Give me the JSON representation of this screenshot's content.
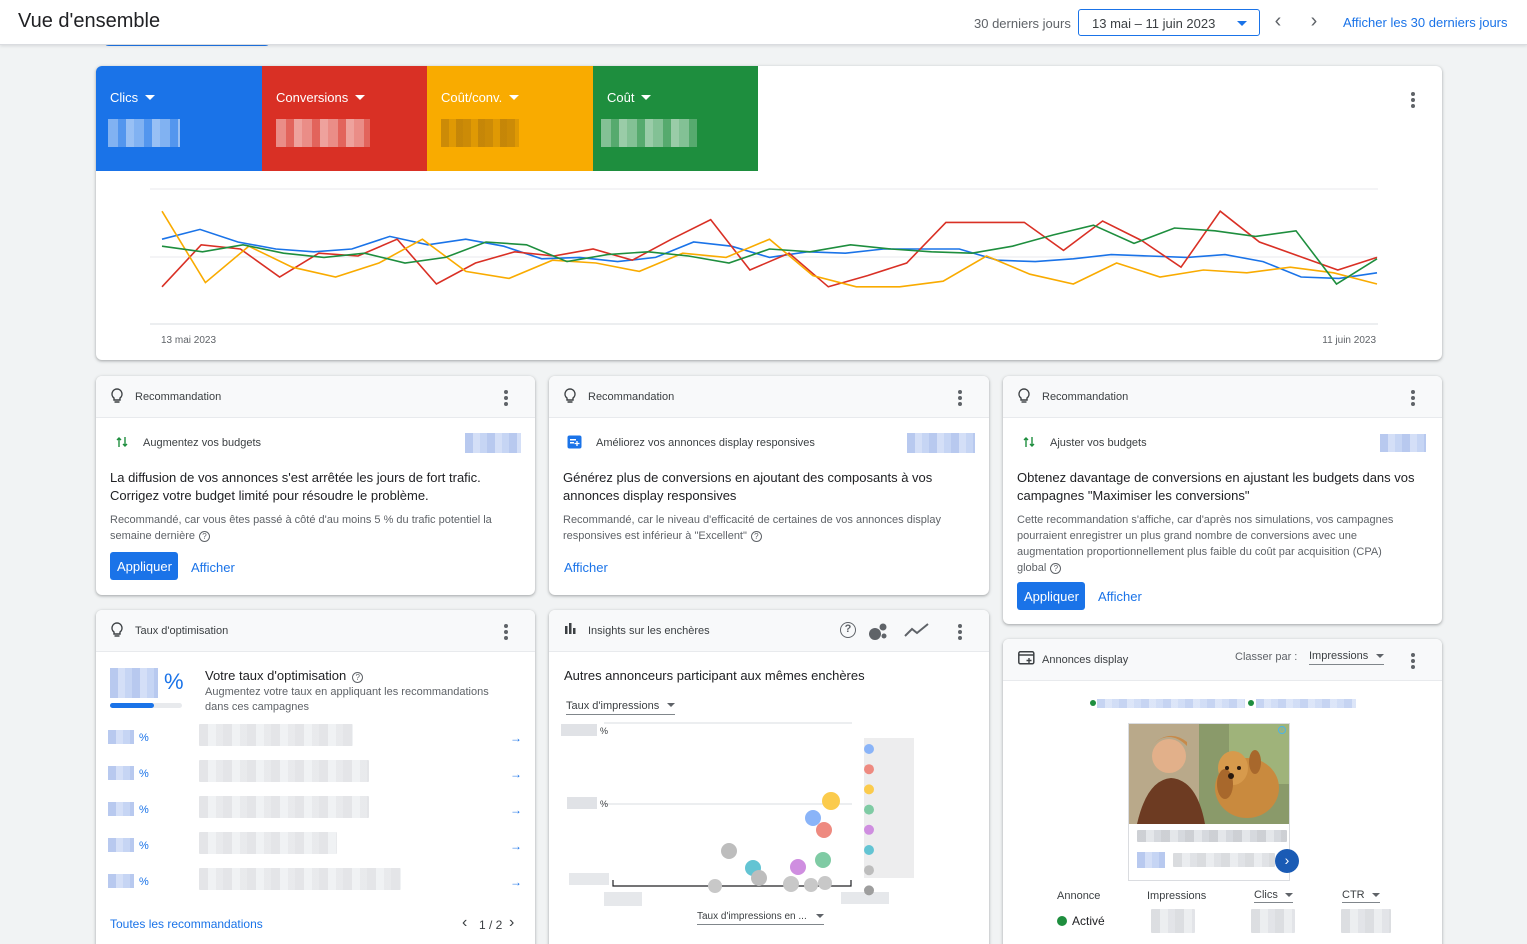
{
  "header": {
    "title": "Vue d'ensemble",
    "range_label": "30 derniers jours",
    "date_range": "13 mai – 11 juin 2023",
    "show_30_link": "Afficher les 30 derniers jours"
  },
  "performance": {
    "metrics": [
      {
        "label": "Clics",
        "color": "#1a73e8"
      },
      {
        "label": "Conversions",
        "color": "#d93025"
      },
      {
        "label": "Coût/conv.",
        "color": "#f9ab00"
      },
      {
        "label": "Coût",
        "color": "#1e8e3e"
      }
    ],
    "x_start": "13 mai 2023",
    "x_end": "11 juin 2023"
  },
  "chart_data": {
    "type": "line",
    "x": [
      "13 mai 2023",
      "",
      "",
      "",
      "",
      "",
      "",
      "",
      "",
      "",
      "",
      "",
      "",
      "",
      "",
      "",
      "",
      "",
      "",
      "",
      "",
      "",
      "",
      "",
      "",
      "",
      "",
      "",
      "",
      "11 juin 2023"
    ],
    "series": [
      {
        "color": "#1a73e8",
        "values": [
          0.62,
          0.69,
          0.6,
          0.55,
          0.53,
          0.55,
          0.64,
          0.58,
          0.62,
          0.57,
          0.48,
          0.49,
          0.46,
          0.49,
          0.6,
          0.57,
          0.49,
          0.53,
          0.52,
          0.55,
          0.55,
          0.55,
          0.47,
          0.46,
          0.48,
          0.51,
          0.5,
          0.49,
          0.51,
          0.46,
          0.35,
          0.34,
          0.38
        ]
      },
      {
        "color": "#d93025",
        "values": [
          0.28,
          0.58,
          0.55,
          0.35,
          0.52,
          0.5,
          0.62,
          0.3,
          0.45,
          0.53,
          0.5,
          0.55,
          0.47,
          0.62,
          0.76,
          0.4,
          0.52,
          0.28,
          0.36,
          0.45,
          0.74,
          0.74,
          0.74,
          0.54,
          0.75,
          0.61,
          0.42,
          0.82,
          0.6,
          0.5,
          0.4,
          0.49
        ]
      },
      {
        "color": "#f9ab00",
        "values": [
          0.82,
          0.31,
          0.57,
          0.42,
          0.35,
          0.45,
          0.62,
          0.39,
          0.34,
          0.47,
          0.45,
          0.39,
          0.52,
          0.49,
          0.62,
          0.36,
          0.28,
          0.28,
          0.32,
          0.5,
          0.37,
          0.3,
          0.45,
          0.35,
          0.4,
          0.38,
          0.42,
          0.38,
          0.3
        ]
      },
      {
        "color": "#1e8e3e",
        "values": [
          0.57,
          0.53,
          0.58,
          0.52,
          0.49,
          0.52,
          0.45,
          0.49,
          0.6,
          0.58,
          0.46,
          0.51,
          0.53,
          0.5,
          0.45,
          0.55,
          0.53,
          0.58,
          0.55,
          0.53,
          0.52,
          0.57,
          0.65,
          0.72,
          0.59,
          0.7,
          0.68,
          0.64,
          0.68,
          0.3,
          0.48
        ]
      }
    ]
  },
  "recommendations": [
    {
      "header": "Recommandation",
      "subtitle": "Augmentez vos budgets",
      "title": "La diffusion de vos annonces s'est arrêtée les jours de fort trafic. Corrigez votre budget limité pour résoudre le problème.",
      "desc": "Recommandé, car vous êtes passé à côté d'au moins 5 % du trafic potentiel la semaine dernière",
      "apply": "Appliquer",
      "view": "Afficher"
    },
    {
      "header": "Recommandation",
      "subtitle": "Améliorez vos annonces display responsives",
      "title": "Générez plus de conversions en ajoutant des composants à vos annonces display responsives",
      "desc": "Recommandé, car le niveau d'efficacité de certaines de vos annonces display responsives est inférieur à \"Excellent\"",
      "view": "Afficher"
    },
    {
      "header": "Recommandation",
      "subtitle": "Ajuster vos budgets",
      "title": "Obtenez davantage de conversions en ajustant les budgets dans vos campagnes \"Maximiser les conversions\"",
      "desc": "Cette recommandation s'affiche, car d'après nos simulations, vos campagnes pourraient enregistrer un plus grand nombre de conversions avec une augmentation proportionnellement plus faible du coût par acquisition (CPA) global",
      "apply": "Appliquer",
      "view": "Afficher"
    }
  ],
  "optimization": {
    "header": "Taux d'optimisation",
    "percent_sign": "%",
    "title": "Votre taux d'optimisation",
    "desc": "Augmentez votre taux en appliquant les recommandations dans ces campagnes",
    "row_pct": "%",
    "rows": 5,
    "footer_link": "Toutes les recommandations",
    "pager": "1 / 2"
  },
  "insights": {
    "header": "Insights sur les enchères",
    "title": "Autres annonceurs participant aux mêmes enchères",
    "y_select": "Taux d'impressions",
    "x_select": "Taux d'impressions en ...",
    "pct": "%"
  },
  "display": {
    "header": "Annonces display",
    "sort_label": "Classer par :",
    "sort_value": "Impressions",
    "col_ad": "Annonce",
    "col_impr": "Impressions",
    "col_clicks": "Clics",
    "col_ctr": "CTR",
    "status": "Activé"
  }
}
